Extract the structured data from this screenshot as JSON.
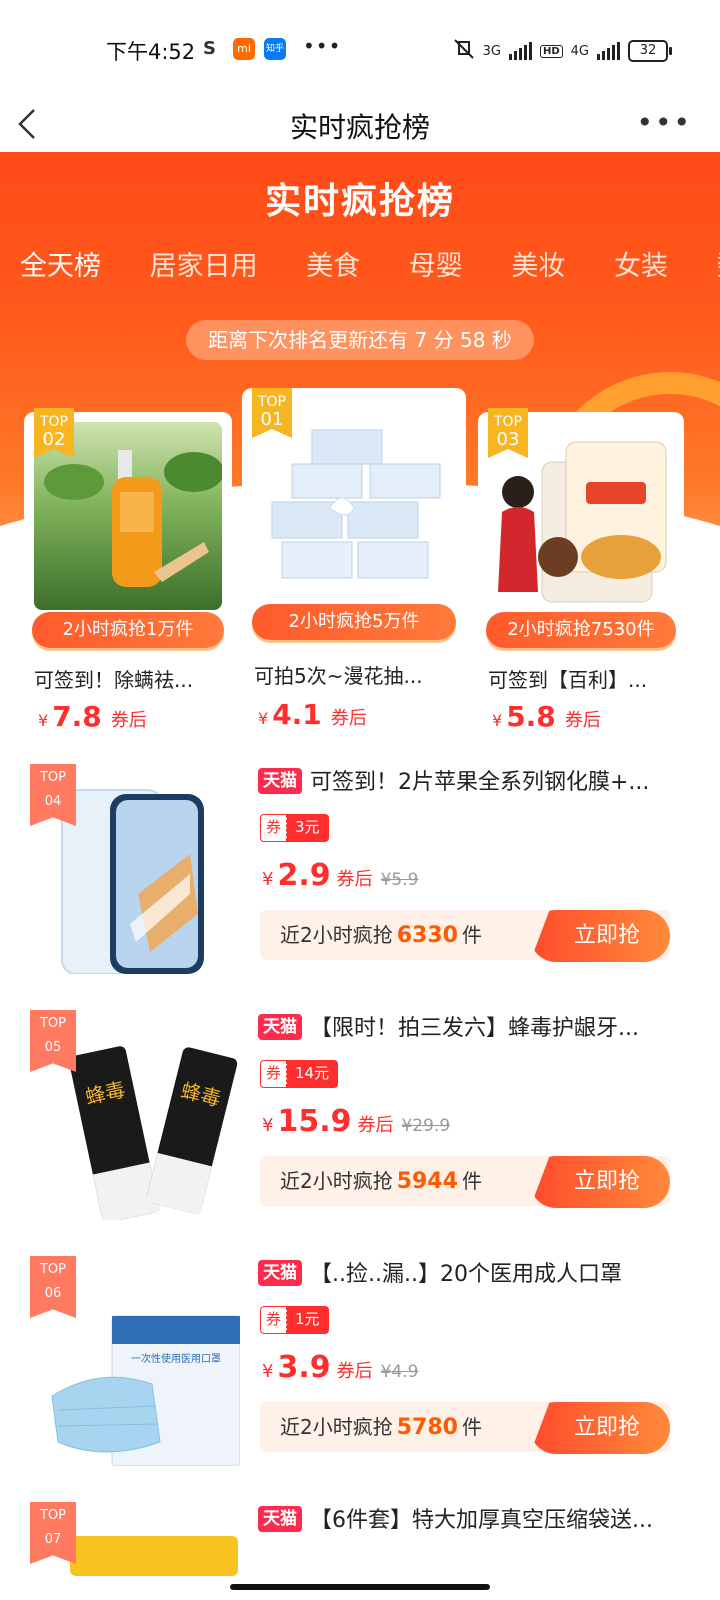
{
  "status_bar": {
    "time": "下午4:52",
    "icons": [
      "s-icon",
      "mi-app-icon",
      "zhihu-app-icon",
      "more-dots"
    ],
    "mi": "mi",
    "zhihu": "知乎",
    "net1": "3G",
    "hd": "HD",
    "net2": "4G",
    "battery": "32"
  },
  "nav": {
    "title": "实时疯抢榜",
    "more": "•••"
  },
  "hero": {
    "title": "实时疯抢榜",
    "tabs": [
      "全天榜",
      "居家日用",
      "美食",
      "母婴",
      "美妆",
      "女装",
      "数码"
    ],
    "countdown": "距离下次排名更新还有 7 分 58 秒",
    "accent": "#ff5a1c"
  },
  "top3": [
    {
      "rank_label": "TOP",
      "rank": "02",
      "sold": "2小时疯抢1万件",
      "name": "可签到！除螨祛...",
      "currency": "¥",
      "price": "7.8",
      "after": "券后"
    },
    {
      "rank_label": "TOP",
      "rank": "01",
      "sold": "2小时疯抢5万件",
      "name": "可拍5次~漫花抽...",
      "currency": "¥",
      "price": "4.1",
      "after": "券后"
    },
    {
      "rank_label": "TOP",
      "rank": "03",
      "sold": "2小时疯抢7530件",
      "name": "可签到【百利】...",
      "currency": "¥",
      "price": "5.8",
      "after": "券后"
    }
  ],
  "items": [
    {
      "rank_label": "TOP",
      "rank": "04",
      "tag": "天猫",
      "name": "可签到！2片苹果全系列钢化膜+...",
      "coupon_label": "券",
      "coupon": "3元",
      "currency": "¥",
      "price": "2.9",
      "after": "券后",
      "orig": "¥5.9",
      "sold_prefix": "近2小时疯抢",
      "sold": "6330",
      "sold_unit": "件",
      "buy": "立即抢"
    },
    {
      "rank_label": "TOP",
      "rank": "05",
      "tag": "天猫",
      "name": "【限时！拍三发六】蜂毒护龈牙...",
      "coupon_label": "券",
      "coupon": "14元",
      "currency": "¥",
      "price": "15.9",
      "after": "券后",
      "orig": "¥29.9",
      "sold_prefix": "近2小时疯抢",
      "sold": "5944",
      "sold_unit": "件",
      "buy": "立即抢",
      "img_text": "蜂毒"
    },
    {
      "rank_label": "TOP",
      "rank": "06",
      "tag": "天猫",
      "name": "【..捡..漏..】20个医用成人口罩",
      "coupon_label": "券",
      "coupon": "1元",
      "currency": "¥",
      "price": "3.9",
      "after": "券后",
      "orig": "¥4.9",
      "sold_prefix": "近2小时疯抢",
      "sold": "5780",
      "sold_unit": "件",
      "buy": "立即抢",
      "img_text": "一次性使用医用口罩"
    },
    {
      "rank_label": "TOP",
      "rank": "07",
      "tag": "天猫",
      "name": "【6件套】特大加厚真空压缩袋送..."
    }
  ]
}
